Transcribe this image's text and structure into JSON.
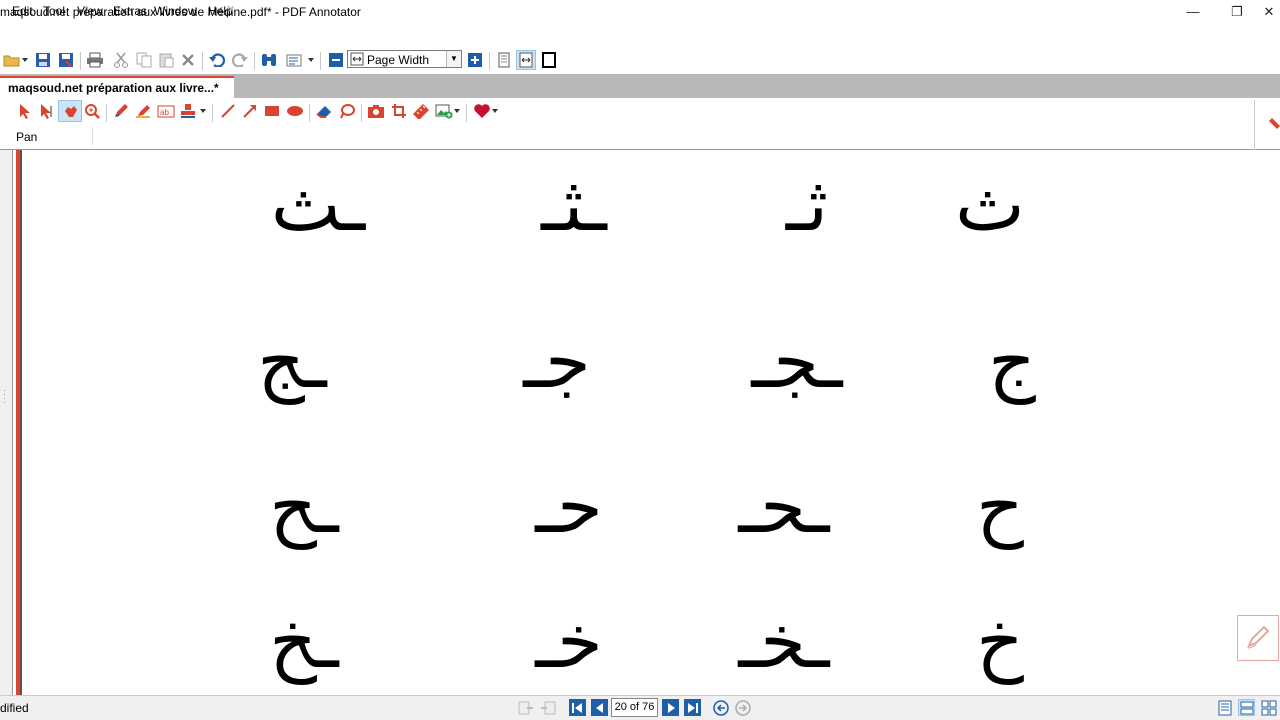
{
  "window": {
    "title": "maqsoud.net préparation aux livres de Médine.pdf* - PDF Annotator",
    "minimize": "—",
    "restore": "❐",
    "close": "✕"
  },
  "menu": {
    "items": [
      "Edit",
      "Tool",
      "View",
      "Extras",
      "Window",
      "Help"
    ]
  },
  "toolbar": {
    "zoom_value": "Page Width"
  },
  "tab": {
    "label": "maqsoud.net préparation aux livre...*",
    "close": "✕"
  },
  "annotation_toolbar": {
    "current_tool": "Pan"
  },
  "document": {
    "rows": [
      [
        "ث",
        "ـثـ",
        "ثـ",
        "ـث"
      ],
      [
        "ج",
        "جـ",
        "ـجـ",
        "ـج"
      ],
      [
        "ح",
        "حـ",
        "ـحـ",
        "ـح"
      ],
      [
        "خ",
        "خـ",
        "ـخـ",
        "ـخ"
      ]
    ]
  },
  "status": {
    "text": "dified",
    "page_indicator": "20 of 76"
  },
  "colors": {
    "accent_red": "#d9432f",
    "accent_blue": "#1f5fa8",
    "heart_red": "#c8102e"
  }
}
